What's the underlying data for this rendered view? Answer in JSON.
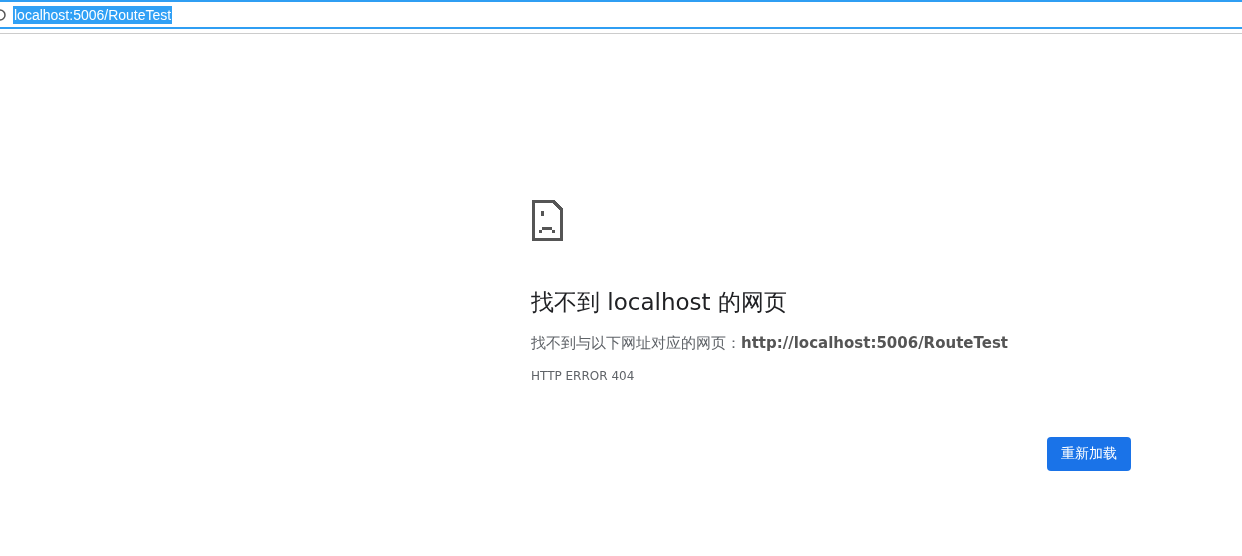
{
  "address_bar": {
    "url": "localhost:5006/RouteTest",
    "selected": true
  },
  "error_page": {
    "heading": "找不到 localhost 的网页",
    "message": "找不到与以下网址对应的网页：**http://localhost:5006/RouteTest**",
    "error_code": "HTTP ERROR 404",
    "button": "重新加载"
  }
}
